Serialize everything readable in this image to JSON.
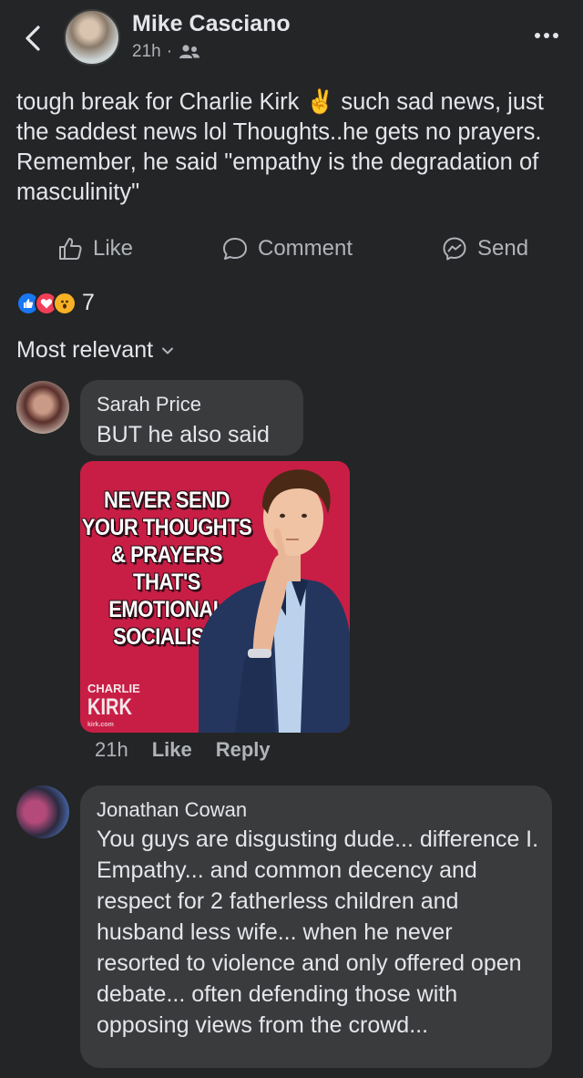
{
  "post": {
    "author": "Mike Casciano",
    "time": "21h",
    "separator": "·",
    "audience_icon": "friends-icon",
    "text": "tough break for Charlie Kirk ✌️ such sad news, just the saddest news lol Thoughts..he gets no prayers. Remember, he said \"empathy is the degradation of masculinity\""
  },
  "actions": {
    "like": "Like",
    "comment": "Comment",
    "send": "Send"
  },
  "reactions": {
    "types": [
      "like",
      "love",
      "wow"
    ],
    "count": "7"
  },
  "sort_label": "Most relevant",
  "comments": [
    {
      "author": "Sarah Price",
      "text": "BUT he also said",
      "image": {
        "lines": [
          "NEVER SEND",
          "YOUR THOUGHTS",
          "& PRAYERS",
          "THAT'S",
          "EMOTIONAL",
          "SOCIALISM"
        ],
        "brand_top": "CHARLIE",
        "brand_bottom": "KIRK",
        "brand_small": "kirk.com"
      },
      "time": "21h",
      "like": "Like",
      "reply": "Reply"
    },
    {
      "author": "Jonathan Cowan",
      "text": "You guys are disgusting dude... difference I. Empathy... and common decency and respect for 2 fatherless children and husband less wife... when he never resorted to violence and only offered open debate... often defending those with opposing views from the crowd..."
    }
  ],
  "colors": {
    "background": "#242526",
    "bubble": "#3a3b3c",
    "text_primary": "#e4e6eb",
    "text_secondary": "#b0b3b8",
    "like_blue": "#1877f2",
    "love_red": "#f33e58",
    "wow_yellow": "#f7b125",
    "meme_red": "#c81e45"
  }
}
